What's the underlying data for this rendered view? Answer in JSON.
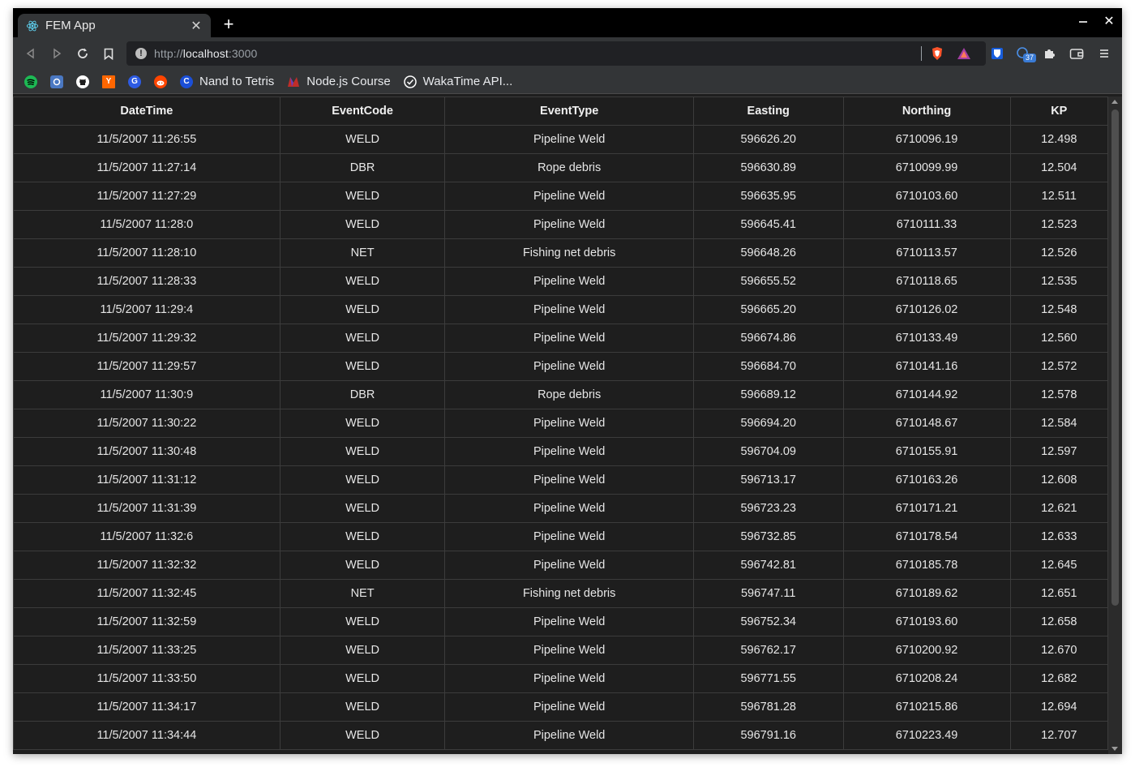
{
  "tab": {
    "title": "FEM App",
    "favicon": "react-icon",
    "close": "✕"
  },
  "newtab": "+",
  "window_controls": {
    "minimize": "—",
    "close": "✕"
  },
  "address": {
    "scheme": "http://",
    "host": "localhost",
    "port": ":3000"
  },
  "extensions": {
    "badge_count": "37"
  },
  "bookmarks": [
    {
      "icon": "spotify-icon",
      "label": "",
      "color": "#1db954"
    },
    {
      "icon": "app-icon",
      "label": "",
      "color": "#4a78c2"
    },
    {
      "icon": "github-icon",
      "label": "",
      "color": "#ffffff"
    },
    {
      "icon": "hackernews-icon",
      "label": "",
      "color": "#ff6600",
      "glyph": "Y"
    },
    {
      "icon": "g-icon",
      "label": "",
      "color": "#2d5be3",
      "glyph": "G"
    },
    {
      "icon": "reddit-icon",
      "label": "",
      "color": "#ff4500"
    },
    {
      "icon": "c-icon",
      "label": "Nand to Tetris",
      "color": "#1b4fd8",
      "glyph": "C"
    },
    {
      "icon": "frontend-masters-icon",
      "label": "Node.js Course",
      "color": "#c02d28"
    },
    {
      "icon": "wakatime-icon",
      "label": "WakaTime API...",
      "color": "#ffffff"
    }
  ],
  "table": {
    "headers": [
      "DateTime",
      "EventCode",
      "EventType",
      "Easting",
      "Northing",
      "KP"
    ],
    "rows": [
      [
        "11/5/2007 11:26:55",
        "WELD",
        "Pipeline Weld",
        "596626.20",
        "6710096.19",
        "12.498"
      ],
      [
        "11/5/2007 11:27:14",
        "DBR",
        "Rope debris",
        "596630.89",
        "6710099.99",
        "12.504"
      ],
      [
        "11/5/2007 11:27:29",
        "WELD",
        "Pipeline Weld",
        "596635.95",
        "6710103.60",
        "12.511"
      ],
      [
        "11/5/2007 11:28:0",
        "WELD",
        "Pipeline Weld",
        "596645.41",
        "6710111.33",
        "12.523"
      ],
      [
        "11/5/2007 11:28:10",
        "NET",
        "Fishing net debris",
        "596648.26",
        "6710113.57",
        "12.526"
      ],
      [
        "11/5/2007 11:28:33",
        "WELD",
        "Pipeline Weld",
        "596655.52",
        "6710118.65",
        "12.535"
      ],
      [
        "11/5/2007 11:29:4",
        "WELD",
        "Pipeline Weld",
        "596665.20",
        "6710126.02",
        "12.548"
      ],
      [
        "11/5/2007 11:29:32",
        "WELD",
        "Pipeline Weld",
        "596674.86",
        "6710133.49",
        "12.560"
      ],
      [
        "11/5/2007 11:29:57",
        "WELD",
        "Pipeline Weld",
        "596684.70",
        "6710141.16",
        "12.572"
      ],
      [
        "11/5/2007 11:30:9",
        "DBR",
        "Rope debris",
        "596689.12",
        "6710144.92",
        "12.578"
      ],
      [
        "11/5/2007 11:30:22",
        "WELD",
        "Pipeline Weld",
        "596694.20",
        "6710148.67",
        "12.584"
      ],
      [
        "11/5/2007 11:30:48",
        "WELD",
        "Pipeline Weld",
        "596704.09",
        "6710155.91",
        "12.597"
      ],
      [
        "11/5/2007 11:31:12",
        "WELD",
        "Pipeline Weld",
        "596713.17",
        "6710163.26",
        "12.608"
      ],
      [
        "11/5/2007 11:31:39",
        "WELD",
        "Pipeline Weld",
        "596723.23",
        "6710171.21",
        "12.621"
      ],
      [
        "11/5/2007 11:32:6",
        "WELD",
        "Pipeline Weld",
        "596732.85",
        "6710178.54",
        "12.633"
      ],
      [
        "11/5/2007 11:32:32",
        "WELD",
        "Pipeline Weld",
        "596742.81",
        "6710185.78",
        "12.645"
      ],
      [
        "11/5/2007 11:32:45",
        "NET",
        "Fishing net debris",
        "596747.11",
        "6710189.62",
        "12.651"
      ],
      [
        "11/5/2007 11:32:59",
        "WELD",
        "Pipeline Weld",
        "596752.34",
        "6710193.60",
        "12.658"
      ],
      [
        "11/5/2007 11:33:25",
        "WELD",
        "Pipeline Weld",
        "596762.17",
        "6710200.92",
        "12.670"
      ],
      [
        "11/5/2007 11:33:50",
        "WELD",
        "Pipeline Weld",
        "596771.55",
        "6710208.24",
        "12.682"
      ],
      [
        "11/5/2007 11:34:17",
        "WELD",
        "Pipeline Weld",
        "596781.28",
        "6710215.86",
        "12.694"
      ],
      [
        "11/5/2007 11:34:44",
        "WELD",
        "Pipeline Weld",
        "596791.16",
        "6710223.49",
        "12.707"
      ]
    ]
  }
}
